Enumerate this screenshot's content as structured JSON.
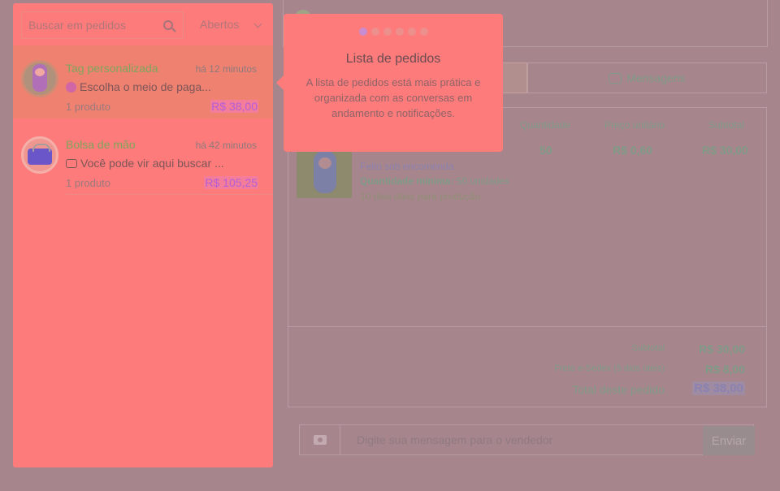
{
  "sidebar": {
    "search_placeholder": "Buscar em pedidos",
    "filter_label": "Abertos",
    "orders": [
      {
        "title": "Tag personalizada",
        "time": "há 12 minutos",
        "status": "Escolha o meio de paga...",
        "count": "1 produto",
        "price": "R$ 38,00"
      },
      {
        "title": "Bolsa de mão",
        "time": "há 42 minutos",
        "status": "Você pode vir aqui buscar ...",
        "count": "1 produto",
        "price": "R$ 105,25"
      }
    ]
  },
  "tooltip": {
    "title": "Lista de pedidos",
    "body": "A lista de pedidos está mais prática e organizada com as conversas em andamento e notificações.",
    "steps_total": 6,
    "step_active": 1
  },
  "main": {
    "tabs": {
      "messages": "Mensagens"
    },
    "table": {
      "col_quantity": "Quantidade",
      "col_unit_price": "Preço unitário",
      "col_subtotal": "Subtotal",
      "quantity": "50",
      "unit_price": "R$ 0,60",
      "subtotal": "R$ 30,00"
    },
    "product": {
      "made_to_order": "Feito sob encomenda",
      "min_qty_label": "Quantidade mínima:",
      "min_qty_value": "50 unidades",
      "production_time": "10 dias úteis para produção"
    },
    "totals": {
      "subtotal_label": "Subtotal",
      "subtotal_value": "R$ 30,00",
      "shipping_label": "Frete e-Sedex (5 dias úteis)",
      "shipping_value": "R$ 8,00",
      "total_label": "Total deste pedido",
      "total_value": "R$ 38,00"
    },
    "composer": {
      "placeholder": "Digite sua mensagem para o vendedor",
      "send_label": "Enviar"
    }
  },
  "colors": {
    "highlight": "#fd7b7b",
    "overlay": "#a7858c",
    "title_green": "#7ea65b",
    "price_purple": "#b45fd5"
  }
}
